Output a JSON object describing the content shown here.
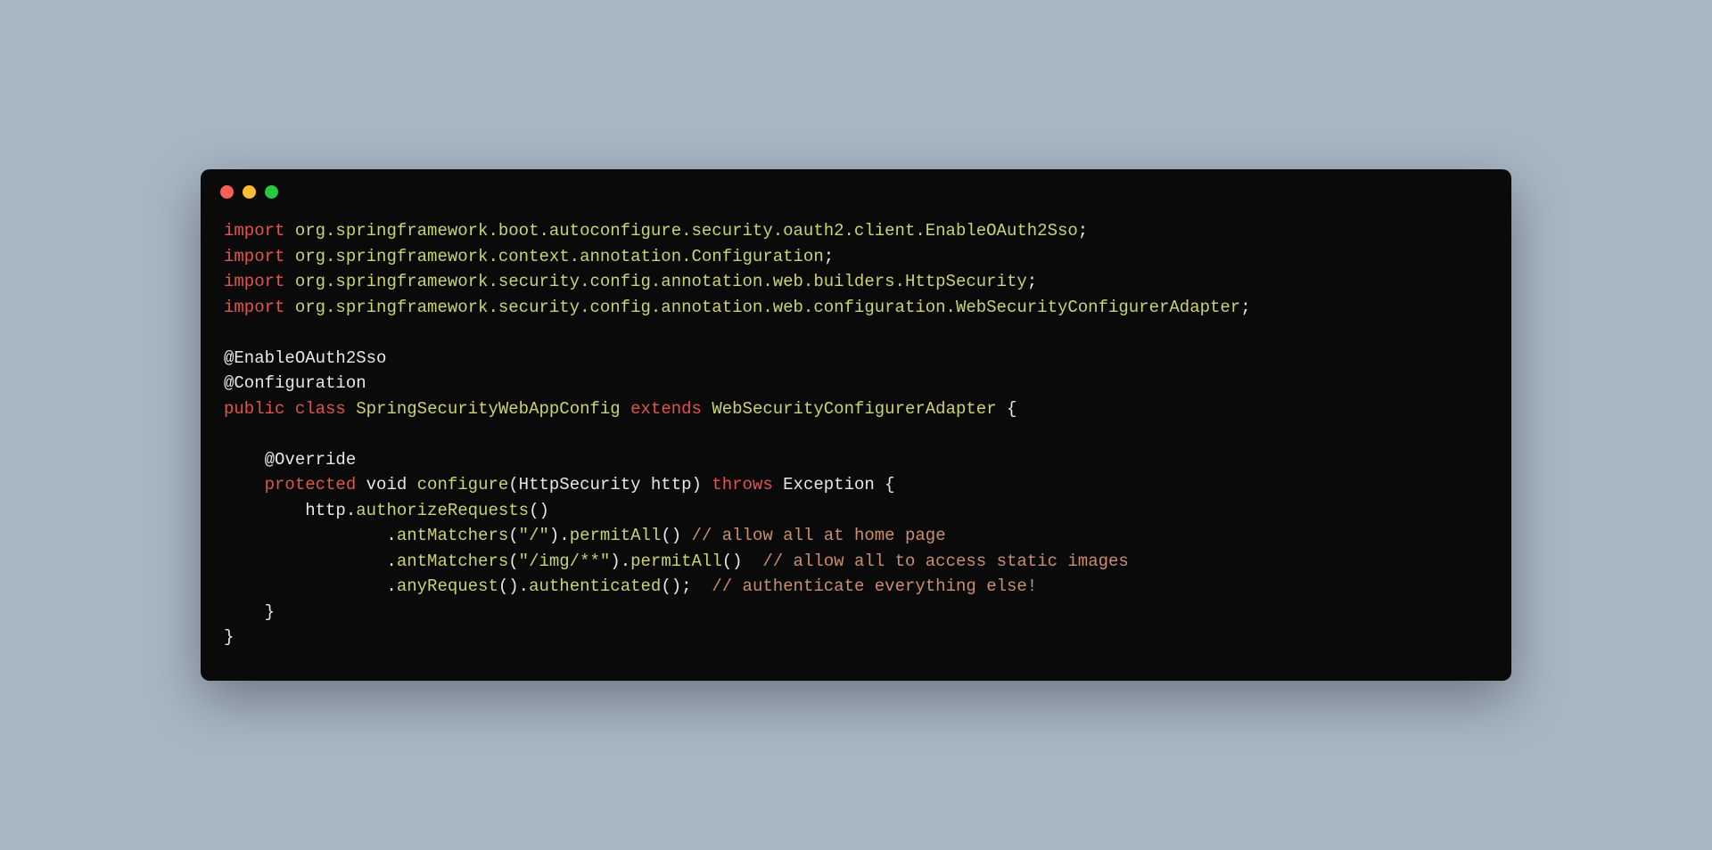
{
  "code": {
    "lines": [
      {
        "segments": [
          {
            "cls": "kw",
            "t": "import"
          },
          {
            "cls": "plain",
            "t": " "
          },
          {
            "cls": "pkg",
            "t": "org.springframework.boot.autoconfigure.security.oauth2.client.EnableOAuth2Sso"
          },
          {
            "cls": "plain",
            "t": ";"
          }
        ]
      },
      {
        "segments": [
          {
            "cls": "kw",
            "t": "import"
          },
          {
            "cls": "plain",
            "t": " "
          },
          {
            "cls": "pkg",
            "t": "org.springframework.context.annotation.Configuration"
          },
          {
            "cls": "plain",
            "t": ";"
          }
        ]
      },
      {
        "segments": [
          {
            "cls": "kw",
            "t": "import"
          },
          {
            "cls": "plain",
            "t": " "
          },
          {
            "cls": "pkg",
            "t": "org.springframework.security.config.annotation.web.builders.HttpSecurity"
          },
          {
            "cls": "plain",
            "t": ";"
          }
        ]
      },
      {
        "segments": [
          {
            "cls": "kw",
            "t": "import"
          },
          {
            "cls": "plain",
            "t": " "
          },
          {
            "cls": "pkg",
            "t": "org.springframework.security.config.annotation.web.configuration.WebSecurityConfigurerAdapter"
          },
          {
            "cls": "plain",
            "t": ";"
          }
        ]
      },
      {
        "segments": [
          {
            "cls": "plain",
            "t": ""
          }
        ]
      },
      {
        "segments": [
          {
            "cls": "annotation",
            "t": "@EnableOAuth2Sso"
          }
        ]
      },
      {
        "segments": [
          {
            "cls": "annotation",
            "t": "@Configuration"
          }
        ]
      },
      {
        "segments": [
          {
            "cls": "kw",
            "t": "public"
          },
          {
            "cls": "plain",
            "t": " "
          },
          {
            "cls": "kw",
            "t": "class"
          },
          {
            "cls": "plain",
            "t": " "
          },
          {
            "cls": "cls",
            "t": "SpringSecurityWebAppConfig"
          },
          {
            "cls": "plain",
            "t": " "
          },
          {
            "cls": "kw",
            "t": "extends"
          },
          {
            "cls": "plain",
            "t": " "
          },
          {
            "cls": "cls",
            "t": "WebSecurityConfigurerAdapter"
          },
          {
            "cls": "plain",
            "t": " {"
          }
        ]
      },
      {
        "segments": [
          {
            "cls": "plain",
            "t": ""
          }
        ]
      },
      {
        "segments": [
          {
            "cls": "plain",
            "t": "    "
          },
          {
            "cls": "annotation",
            "t": "@Override"
          }
        ]
      },
      {
        "segments": [
          {
            "cls": "plain",
            "t": "    "
          },
          {
            "cls": "kw",
            "t": "protected"
          },
          {
            "cls": "plain",
            "t": " "
          },
          {
            "cls": "plain",
            "t": "void"
          },
          {
            "cls": "plain",
            "t": " "
          },
          {
            "cls": "method",
            "t": "configure"
          },
          {
            "cls": "plain",
            "t": "(HttpSecurity http) "
          },
          {
            "cls": "kw",
            "t": "throws"
          },
          {
            "cls": "plain",
            "t": " Exception {"
          }
        ]
      },
      {
        "segments": [
          {
            "cls": "plain",
            "t": "        http."
          },
          {
            "cls": "method",
            "t": "authorizeRequests"
          },
          {
            "cls": "plain",
            "t": "()"
          }
        ]
      },
      {
        "segments": [
          {
            "cls": "plain",
            "t": "                ."
          },
          {
            "cls": "method",
            "t": "antMatchers"
          },
          {
            "cls": "plain",
            "t": "("
          },
          {
            "cls": "string",
            "t": "\"/\""
          },
          {
            "cls": "plain",
            "t": ")."
          },
          {
            "cls": "method",
            "t": "permitAll"
          },
          {
            "cls": "plain",
            "t": "() "
          },
          {
            "cls": "comment",
            "t": "// allow all at home page"
          }
        ]
      },
      {
        "segments": [
          {
            "cls": "plain",
            "t": "                ."
          },
          {
            "cls": "method",
            "t": "antMatchers"
          },
          {
            "cls": "plain",
            "t": "("
          },
          {
            "cls": "string",
            "t": "\"/img/**\""
          },
          {
            "cls": "plain",
            "t": ")."
          },
          {
            "cls": "method",
            "t": "permitAll"
          },
          {
            "cls": "plain",
            "t": "()  "
          },
          {
            "cls": "comment",
            "t": "// allow all to access static images"
          }
        ]
      },
      {
        "segments": [
          {
            "cls": "plain",
            "t": "                ."
          },
          {
            "cls": "method",
            "t": "anyRequest"
          },
          {
            "cls": "plain",
            "t": "()."
          },
          {
            "cls": "method",
            "t": "authenticated"
          },
          {
            "cls": "plain",
            "t": "();  "
          },
          {
            "cls": "comment",
            "t": "// authenticate everything else!"
          }
        ]
      },
      {
        "segments": [
          {
            "cls": "plain",
            "t": "    }"
          }
        ]
      },
      {
        "segments": [
          {
            "cls": "plain",
            "t": "}"
          }
        ]
      }
    ]
  }
}
